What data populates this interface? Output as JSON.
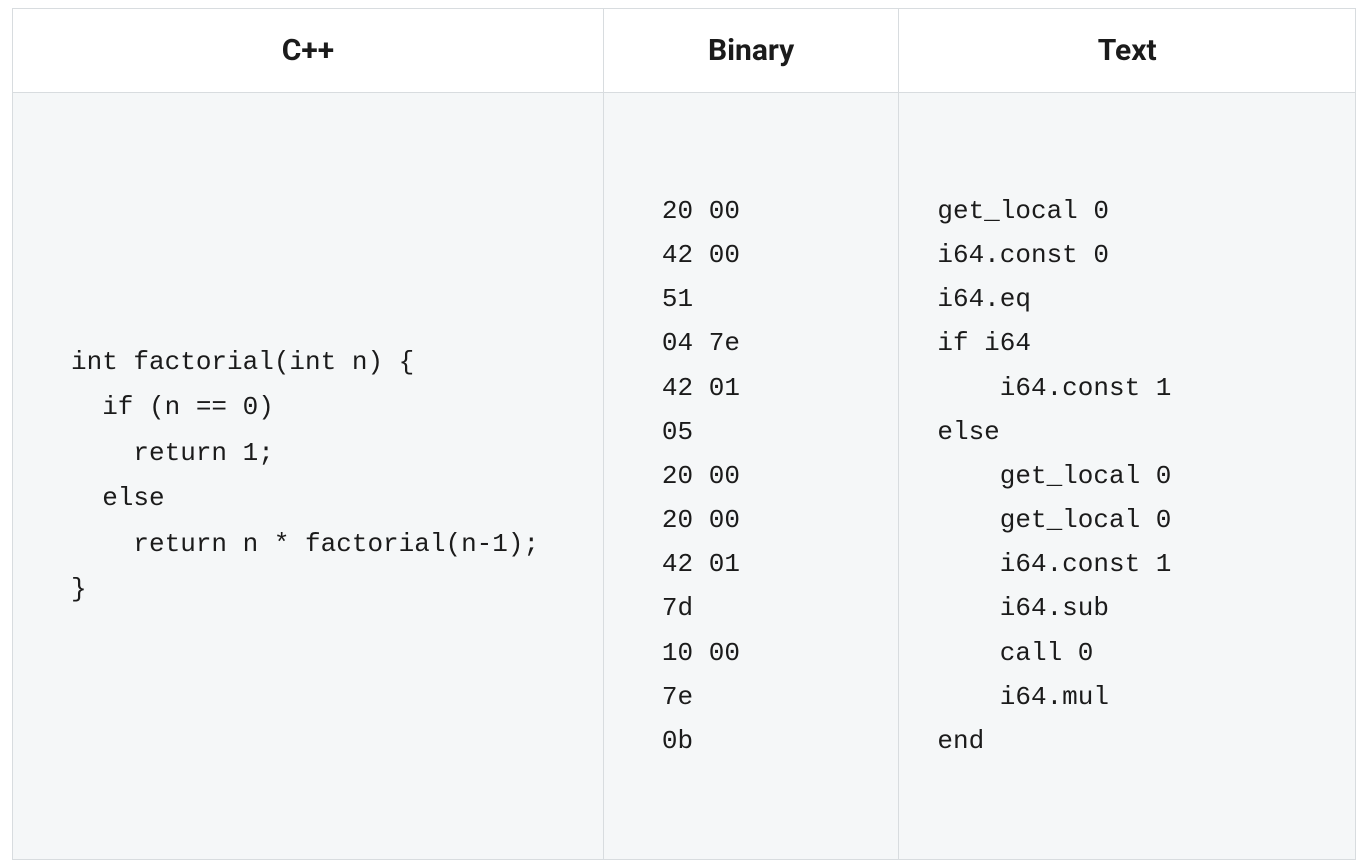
{
  "headers": {
    "cpp": "C++",
    "binary": "Binary",
    "text": "Text"
  },
  "cpp_code": "int factorial(int n) {\n  if (n == 0)\n    return 1;\n  else\n    return n * factorial(n-1);\n}",
  "binary_code": "20 00\n42 00\n51\n04 7e\n42 01\n05\n20 00\n20 00\n42 01\n7d\n10 00\n7e\n0b",
  "text_code": "get_local 0\ni64.const 0\ni64.eq\nif i64\n    i64.const 1\nelse\n    get_local 0\n    get_local 0\n    i64.const 1\n    i64.sub\n    call 0\n    i64.mul\nend"
}
